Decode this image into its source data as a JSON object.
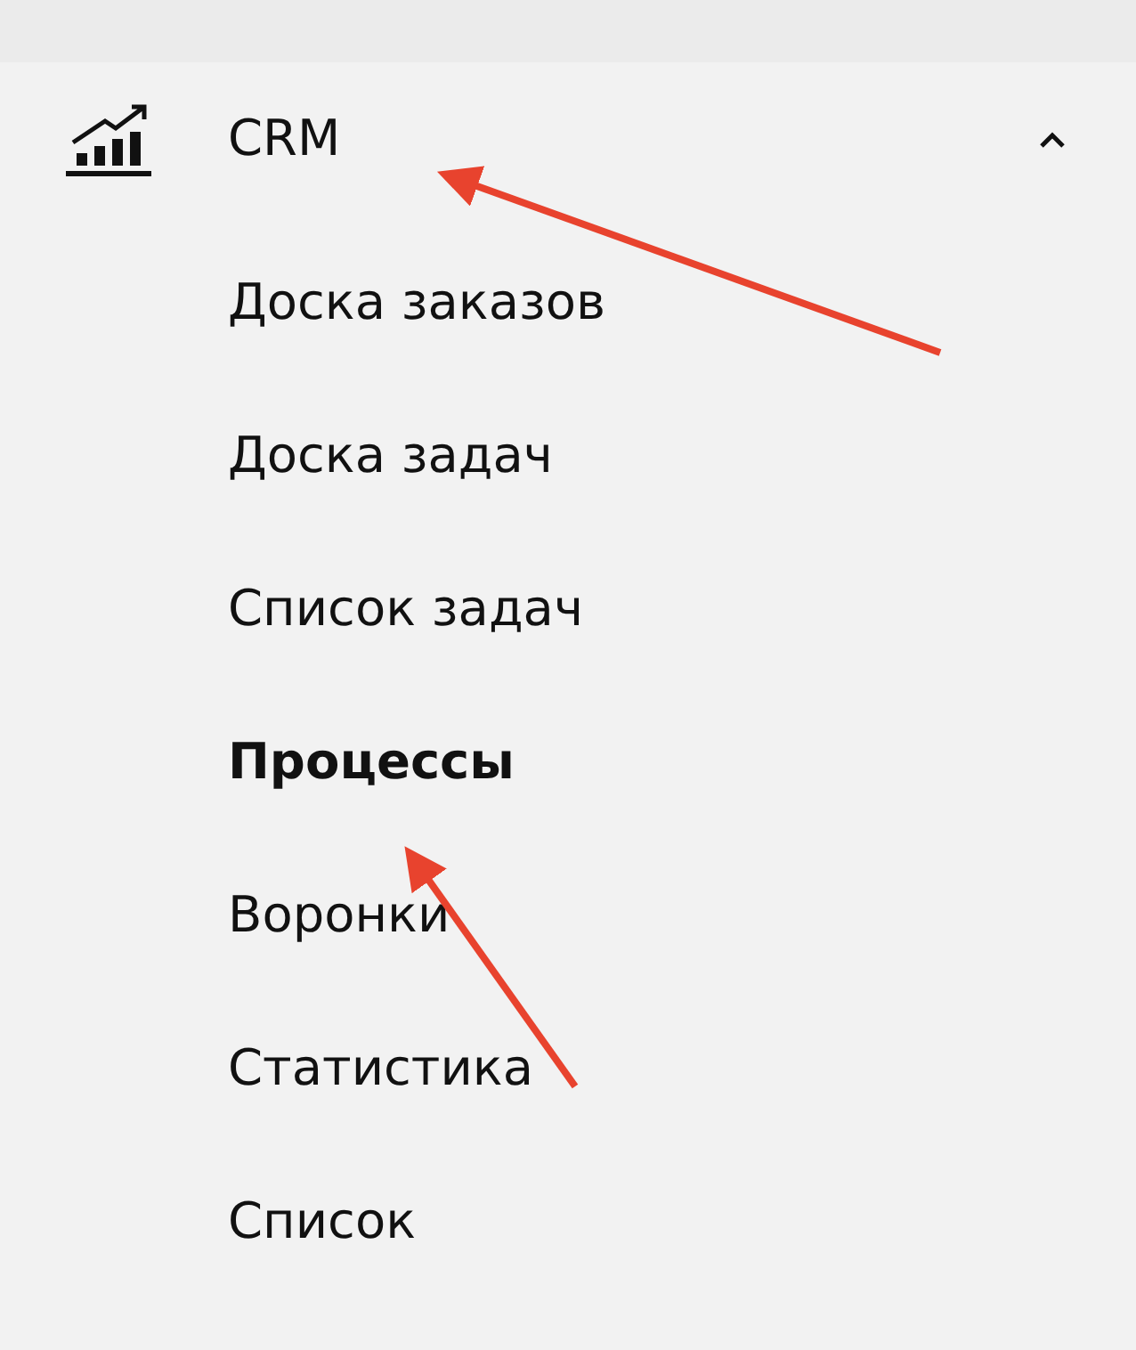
{
  "menu": {
    "title": "CRM",
    "expanded": true,
    "items": [
      {
        "label": "Доска заказов",
        "selected": false
      },
      {
        "label": "Доска задач",
        "selected": false
      },
      {
        "label": "Список задач",
        "selected": false
      },
      {
        "label": "Процессы",
        "selected": true
      },
      {
        "label": "Воронки",
        "selected": false
      },
      {
        "label": "Статистика",
        "selected": false
      },
      {
        "label": "Список",
        "selected": false
      }
    ]
  }
}
